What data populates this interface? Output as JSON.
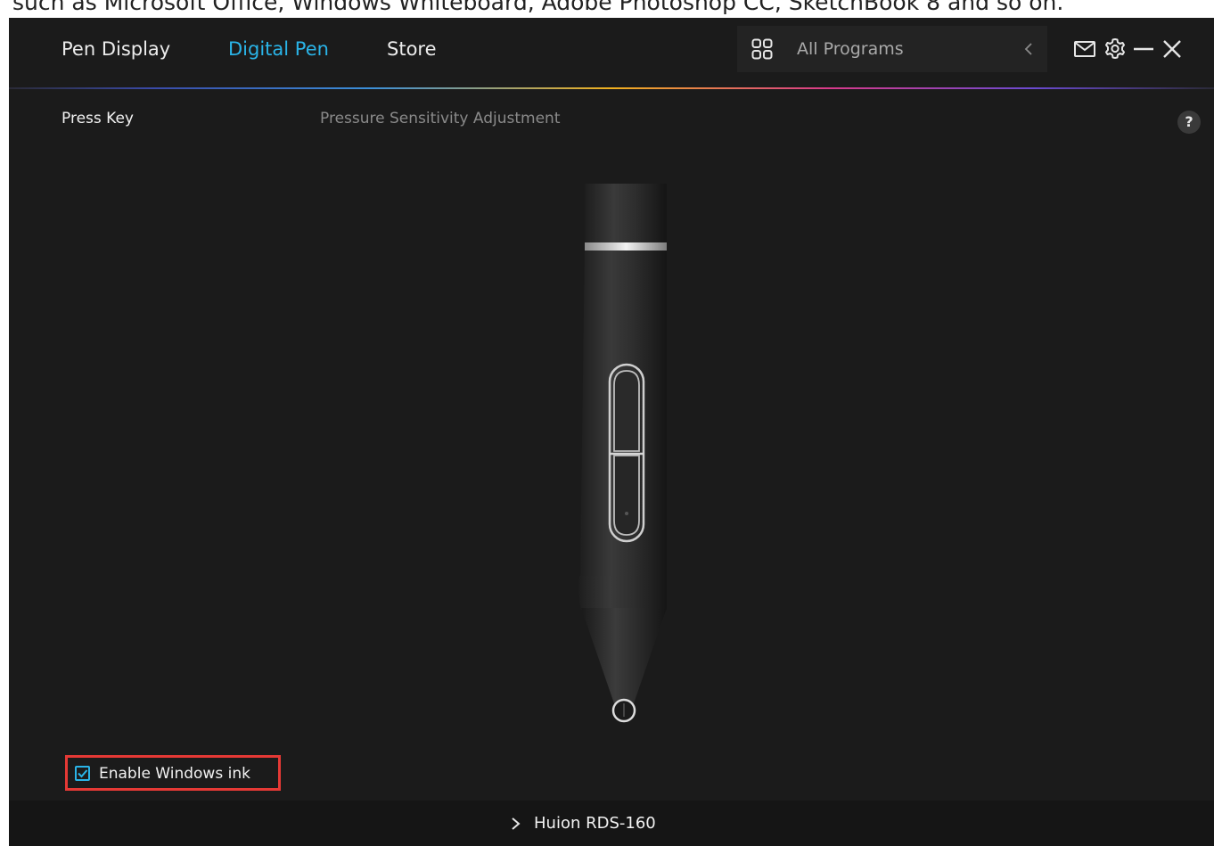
{
  "caption": {
    "text": "such as Microsoft Office, Windows Whiteboard, Adobe Photoshop CC, SketchBook 8 and so on."
  },
  "header": {
    "tabs": [
      {
        "label": "Pen Display",
        "active": false
      },
      {
        "label": "Digital Pen",
        "active": true
      },
      {
        "label": "Store",
        "active": false
      }
    ],
    "program_selector": {
      "label": "All Programs",
      "icon": "grid-icon",
      "arrow_icon": "chevron-left-icon"
    },
    "icons": [
      "mail-icon",
      "gear-icon",
      "minimize-icon",
      "close-icon"
    ],
    "accent_color": "#2ab4e8"
  },
  "subtabs": [
    {
      "label": "Press Key",
      "active": true
    },
    {
      "label": "Pressure Sensitivity Adjustment",
      "active": false
    }
  ],
  "help": {
    "label": "?"
  },
  "windows_ink": {
    "label": "Enable Windows ink",
    "checked": true,
    "highlight_color": "#e53935"
  },
  "footer": {
    "device_name": "Huion RDS-160",
    "icon": "chevron-right-icon"
  }
}
